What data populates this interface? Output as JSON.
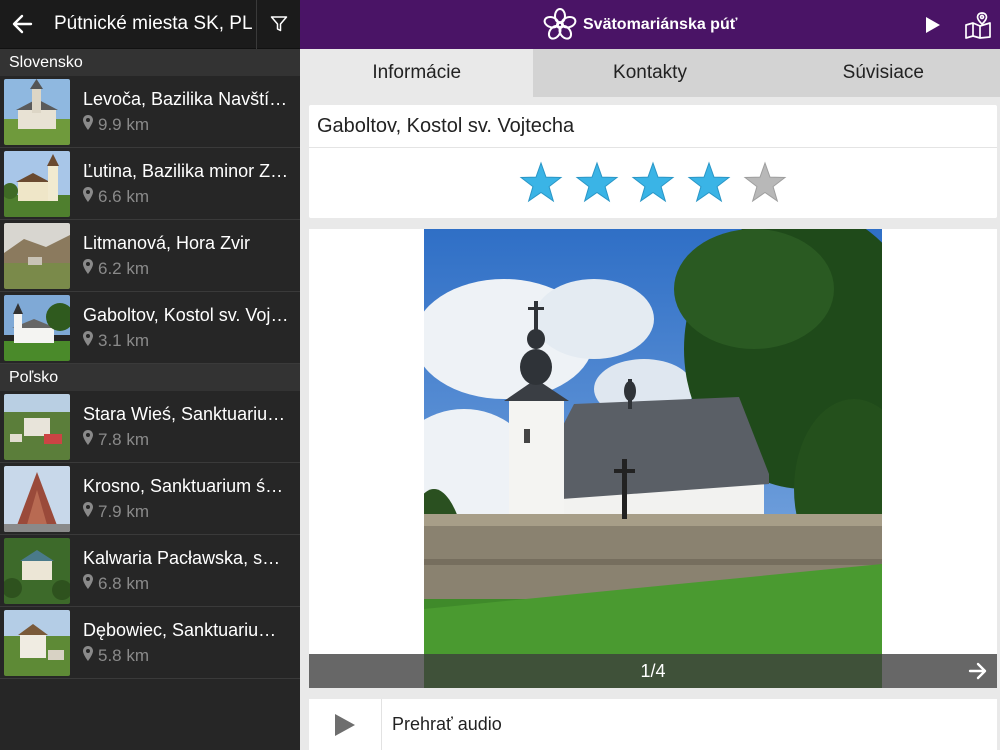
{
  "sidebar": {
    "title": "Pútnické miesta SK, PL",
    "sections": [
      {
        "header": "Slovensko"
      },
      {
        "header": "Poľsko"
      }
    ],
    "places": [
      {
        "name": "Levoča, Bazilika Navštívenia Panny Márie",
        "distance": "9.9 km"
      },
      {
        "name": "Ľutina, Bazilika minor Zoslania Ducha Svätého",
        "distance": "6.6 km"
      },
      {
        "name": "Litmanová, Hora Zvir",
        "distance": "6.2 km"
      },
      {
        "name": "Gaboltov, Kostol sv. Vojtecha",
        "distance": "3.1 km"
      },
      {
        "name": "Stara Wieś, Sanktuarium Matki Bożej",
        "distance": "7.8 km"
      },
      {
        "name": "Krosno, Sanktuarium św. Jana z Dukli",
        "distance": "7.9 km"
      },
      {
        "name": "Kalwaria Pacławska, sanktuarium",
        "distance": "6.8 km"
      },
      {
        "name": "Dębowiec, Sanktuarium Matki Bożej",
        "distance": "5.8 km"
      }
    ]
  },
  "topbar": {
    "brand": "Svätomariánska púť"
  },
  "tabs": [
    "Informácie",
    "Kontakty",
    "Súvisiace"
  ],
  "active_tab": "Informácie",
  "detail": {
    "title": "Gaboltov, Kostol sv. Vojtecha",
    "rating": 4,
    "rating_max": 5,
    "photo_counter": "1/4",
    "audio_label": "Prehrať audio"
  },
  "colors": {
    "accent": "#4a1466",
    "star_filled": "#3ab4e6",
    "star_empty": "#b8b8b8"
  },
  "icons": [
    "back-arrow-icon",
    "filter-icon",
    "flower-logo-icon",
    "play-icon",
    "map-icon",
    "location-pin-icon",
    "arrow-right-icon"
  ]
}
